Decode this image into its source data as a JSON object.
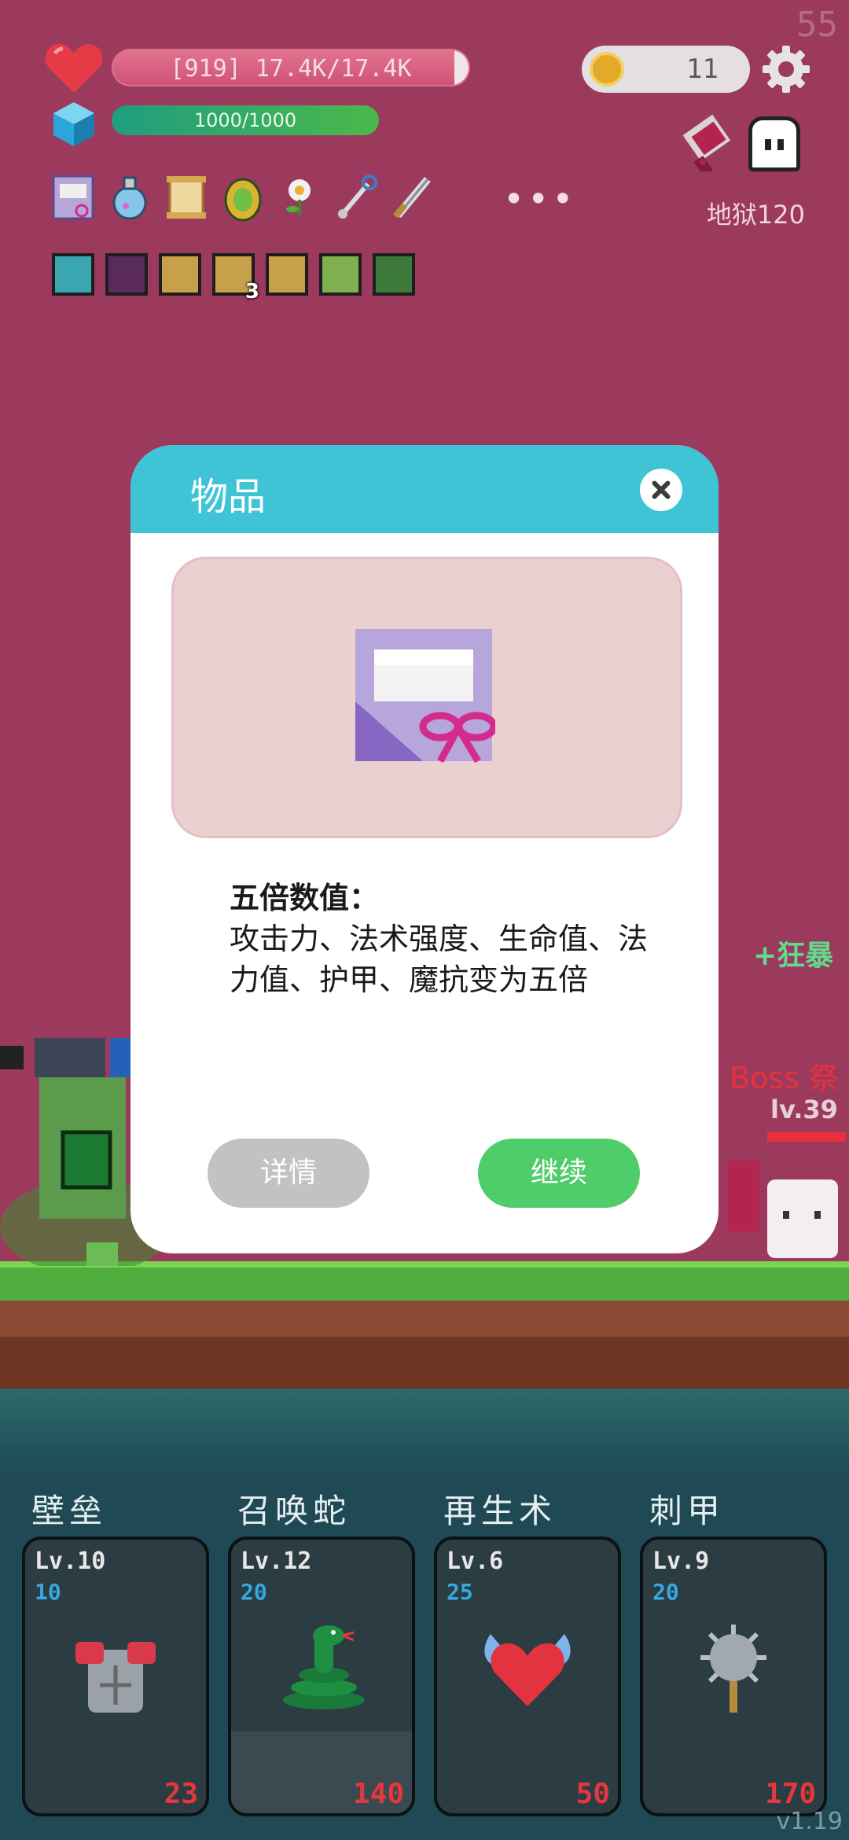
{
  "hud": {
    "fps": "55",
    "hp_text": "[919] 17.4K/17.4K",
    "hp_fraction": 0.96,
    "mp_text": "1000/1000",
    "mp_fraction": 1.0,
    "coins": "11",
    "stage": "地狱120"
  },
  "items": [
    "gift-scroll-icon",
    "potion-icon",
    "scroll-icon",
    "golden-egg-icon",
    "flower-icon",
    "pin-icon",
    "sword-icon"
  ],
  "more": "•••",
  "buffs": [
    {
      "icon": "lamp-buff-icon",
      "count": ""
    },
    {
      "icon": "demon-buff-icon",
      "count": ""
    },
    {
      "icon": "shield-buff-icon",
      "count": ""
    },
    {
      "icon": "shield-buff-icon",
      "count": "3"
    },
    {
      "icon": "shield-buff-icon",
      "count": ""
    },
    {
      "icon": "leaf-buff-icon",
      "count": ""
    },
    {
      "icon": "snake-buff-icon",
      "count": ""
    }
  ],
  "battle": {
    "rage": "+狂暴",
    "boss": "Boss 祭",
    "boss_level": "lv.39"
  },
  "modal": {
    "title": "物品",
    "desc_title": "五倍数值：",
    "desc_body": "攻击力、法术强度、生命值、法力值、护甲、魔抗变为五倍",
    "details_label": "详情",
    "continue_label": "继续"
  },
  "skills": [
    {
      "name": "壁垒",
      "level": "Lv.10",
      "cost": "10",
      "price": "23",
      "icon": "armor-icon",
      "cooldown": 0
    },
    {
      "name": "召唤蛇",
      "level": "Lv.12",
      "cost": "20",
      "price": "140",
      "icon": "snake-icon",
      "cooldown": 0.3
    },
    {
      "name": "再生术",
      "level": "Lv.6",
      "cost": "25",
      "price": "50",
      "icon": "winged-heart-icon",
      "cooldown": 0
    },
    {
      "name": "刺甲",
      "level": "Lv.9",
      "cost": "20",
      "price": "170",
      "icon": "spiked-mace-icon",
      "cooldown": 0
    }
  ],
  "version": "v1.19",
  "colors": {
    "background": "#9c3a5e",
    "modal_header": "#3fc4d6",
    "continue": "#4ecd6a",
    "details": "#c2c2c2",
    "rage": "#63d98d",
    "boss": "#e8313a",
    "price": "#e6363e",
    "cost": "#36a9e0"
  }
}
